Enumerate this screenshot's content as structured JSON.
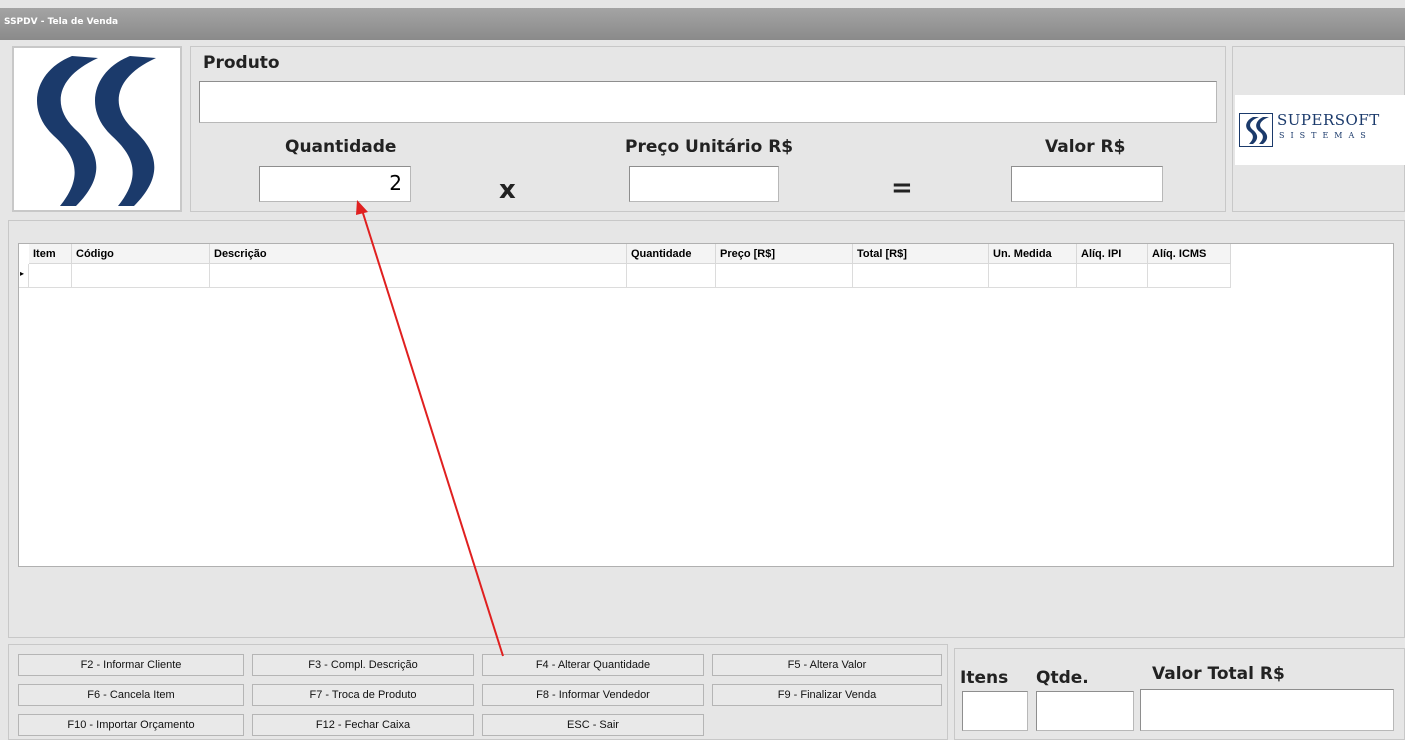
{
  "window": {
    "title": "SSPDV - Tela de Venda"
  },
  "product": {
    "label": "Produto",
    "value": "",
    "quantity_label": "Quantidade",
    "quantity_value": "2",
    "times_symbol": "x",
    "unit_price_label": "Preço Unitário R$",
    "unit_price_value": "",
    "equals_symbol": "=",
    "value_label": "Valor R$",
    "value_value": ""
  },
  "brand": {
    "name": "SUPERSOFT",
    "subtitle": "SISTEMAS",
    "accent": "#1b3a6b"
  },
  "grid": {
    "columns": [
      "Item",
      "Código",
      "Descrição",
      "Quantidade",
      "Preço [R$]",
      "Total [R$]",
      "Un. Medida",
      "Alíq. IPI",
      "Alíq. ICMS"
    ],
    "row_indicator": "▸"
  },
  "function_keys": [
    "F2 - Informar Cliente",
    "F3 - Compl. Descrição",
    "F4 - Alterar Quantidade",
    "F5 - Altera Valor",
    "F6 - Cancela Item",
    "F7 - Troca de Produto",
    "F8 - Informar Vendedor",
    "F9 - Finalizar Venda",
    "F10 - Importar Orçamento",
    "F12 - Fechar Caixa",
    "ESC - Sair"
  ],
  "totals": {
    "items_label": "Itens",
    "items_value": "",
    "qty_label": "Qtde.",
    "qty_value": "",
    "total_label": "Valor Total R$",
    "total_value": ""
  },
  "annotation": {
    "color": "#e02020"
  }
}
